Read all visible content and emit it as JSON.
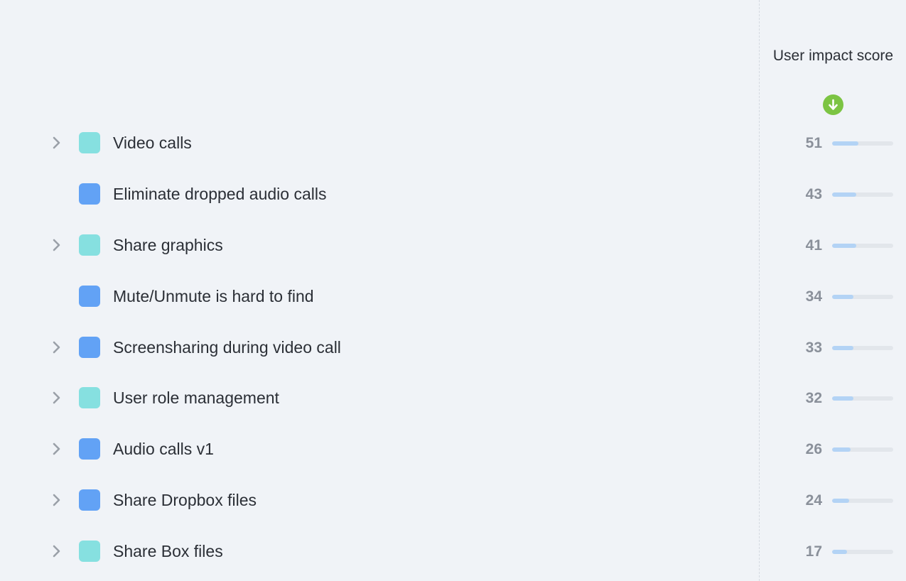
{
  "header": {
    "score_column_title": "User impact score",
    "sort_icon": "arrow-down-icon",
    "sort_color": "#7cc443"
  },
  "colors": {
    "teal": "#86e0e0",
    "blue": "#62a2f5"
  },
  "rows": [
    {
      "label": "Video calls",
      "score": "51",
      "expandable": true,
      "swatch": "#86e0e0",
      "bar_fraction": 0.43
    },
    {
      "label": "Eliminate dropped audio calls",
      "score": "43",
      "expandable": false,
      "swatch": "#62a2f5",
      "bar_fraction": 0.39
    },
    {
      "label": "Share graphics",
      "score": "41",
      "expandable": true,
      "swatch": "#86e0e0",
      "bar_fraction": 0.39
    },
    {
      "label": "Mute/Unmute is hard to find",
      "score": "34",
      "expandable": false,
      "swatch": "#62a2f5",
      "bar_fraction": 0.35
    },
    {
      "label": "Screensharing during video call",
      "score": "33",
      "expandable": true,
      "swatch": "#62a2f5",
      "bar_fraction": 0.35
    },
    {
      "label": "User role management",
      "score": "32",
      "expandable": true,
      "swatch": "#86e0e0",
      "bar_fraction": 0.35
    },
    {
      "label": "Audio calls v1",
      "score": "26",
      "expandable": true,
      "swatch": "#62a2f5",
      "bar_fraction": 0.3
    },
    {
      "label": "Share Dropbox files",
      "score": "24",
      "expandable": true,
      "swatch": "#62a2f5",
      "bar_fraction": 0.28
    },
    {
      "label": "Share Box files",
      "score": "17",
      "expandable": true,
      "swatch": "#86e0e0",
      "bar_fraction": 0.24
    }
  ]
}
